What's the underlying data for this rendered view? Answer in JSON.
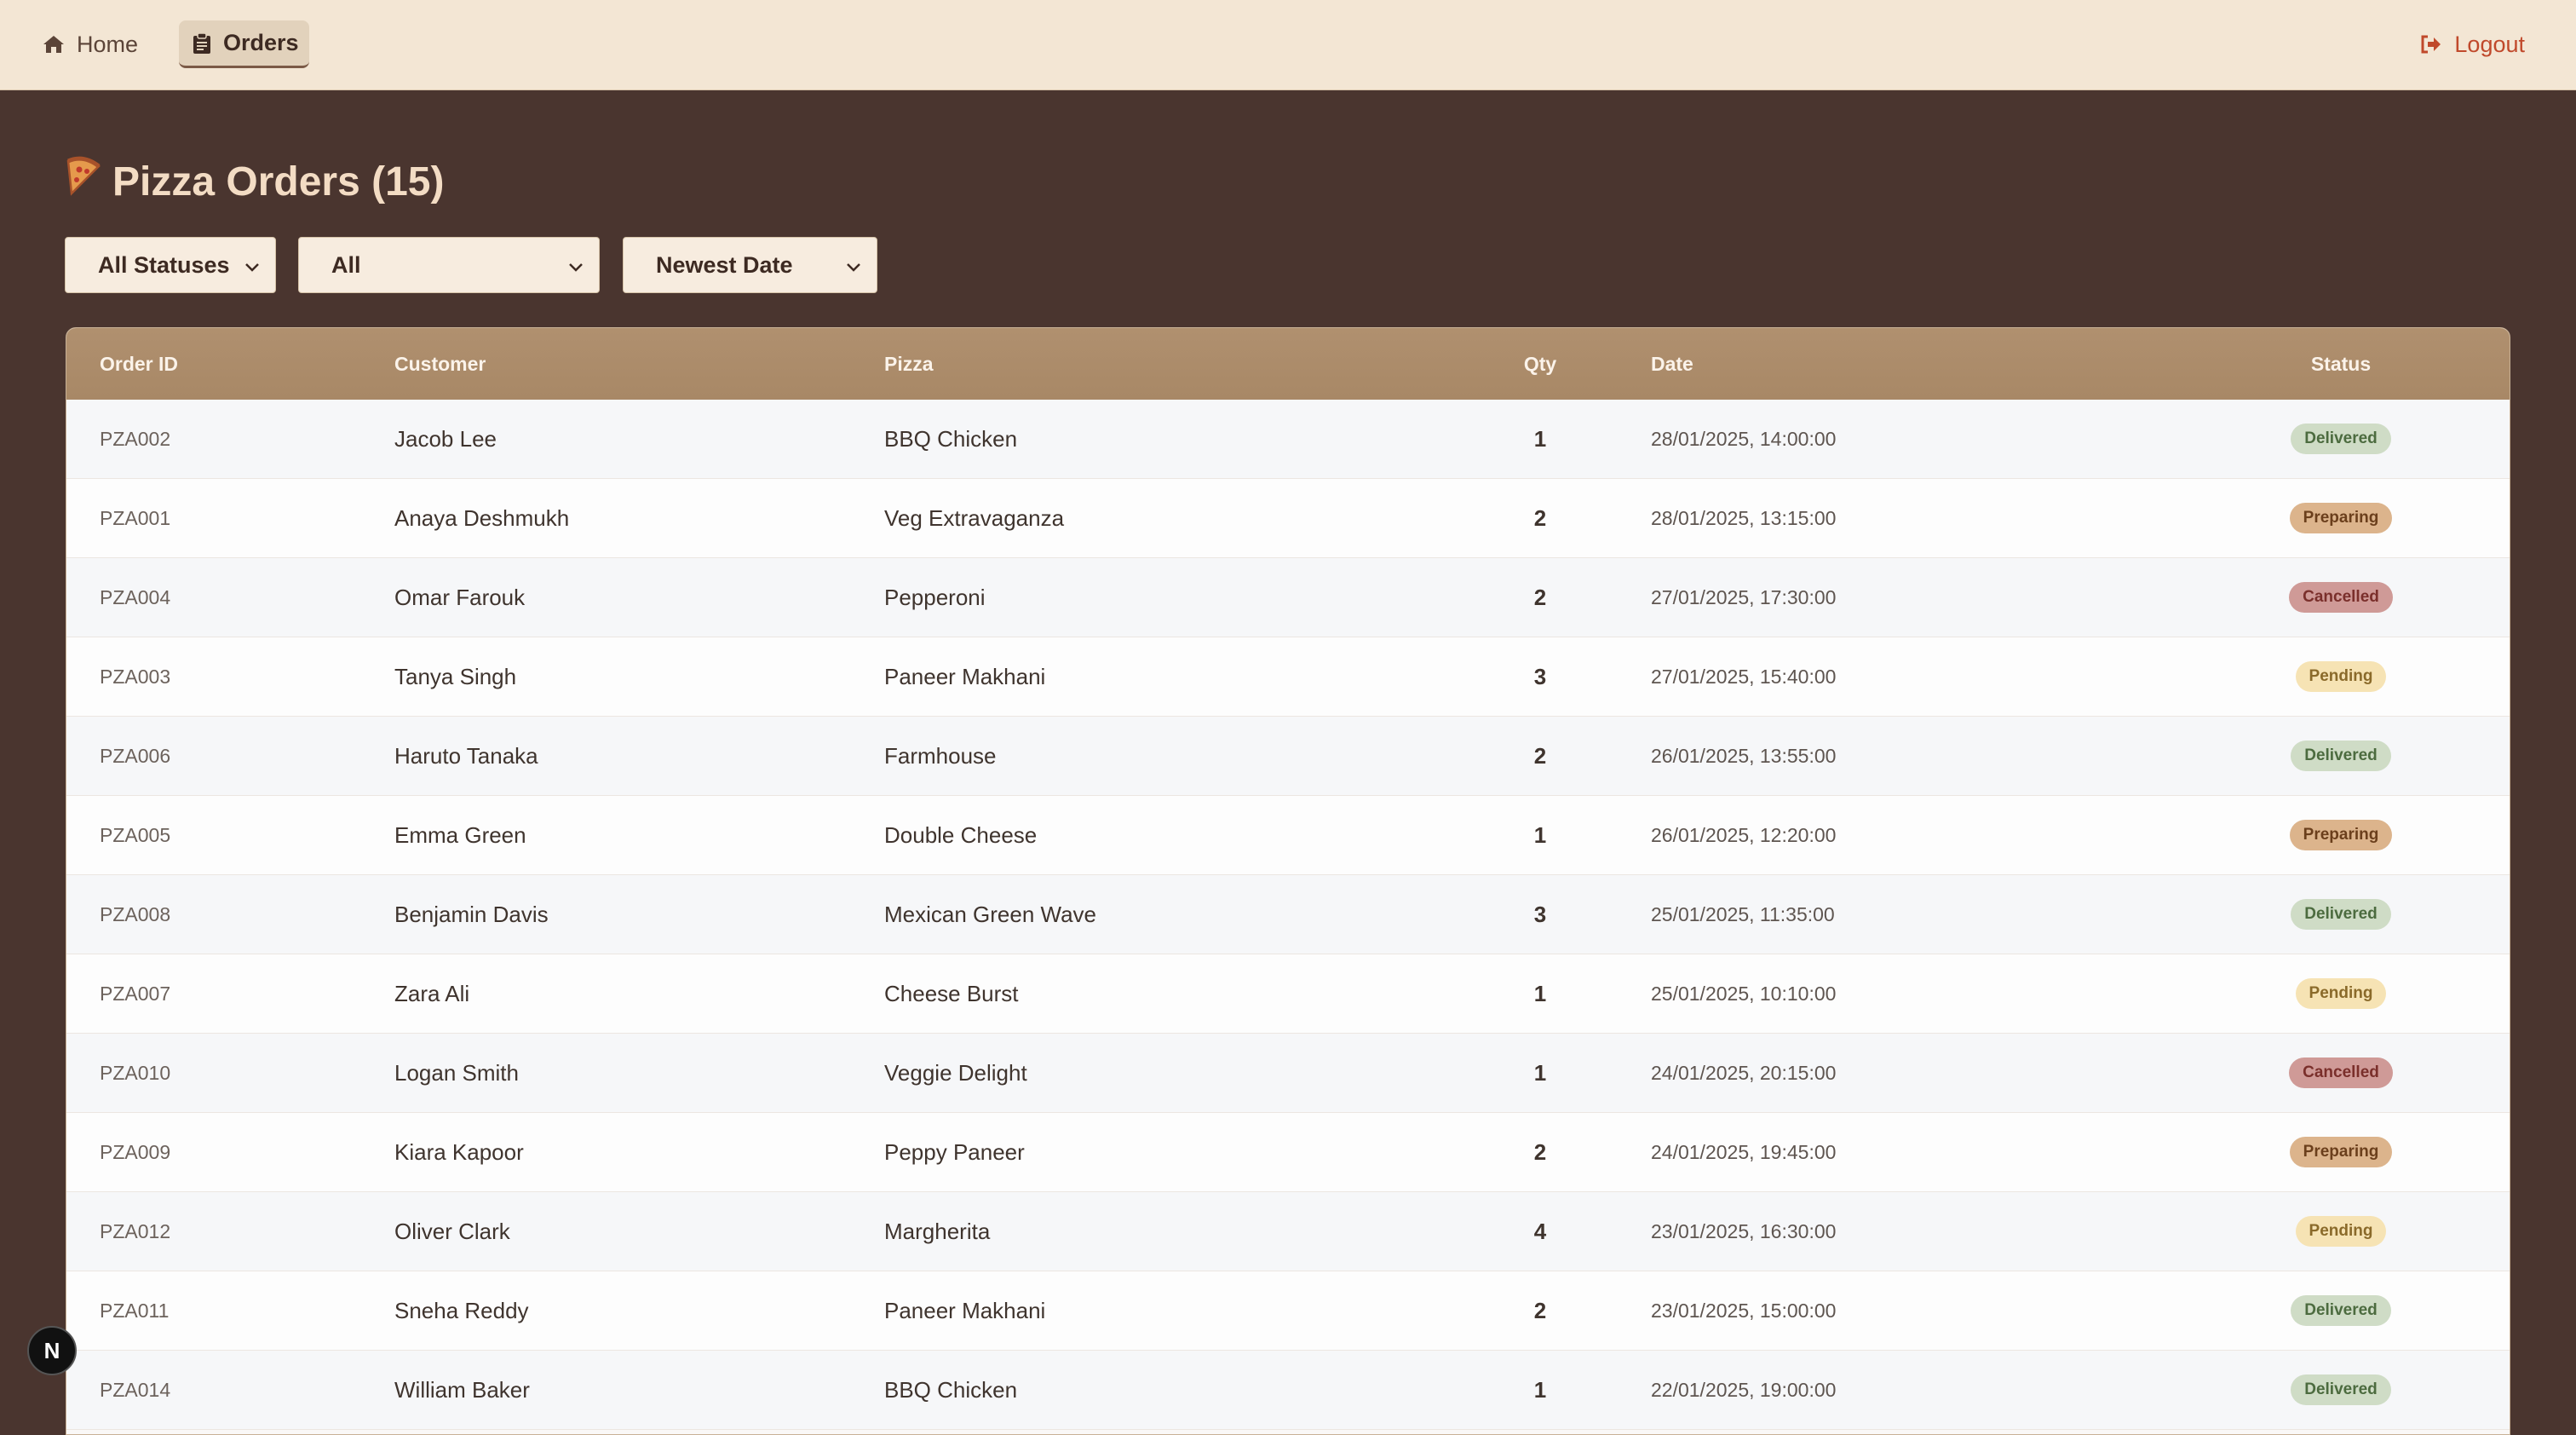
{
  "nav": {
    "home_label": "Home",
    "orders_label": "Orders",
    "logout_label": "Logout"
  },
  "page": {
    "title": "Pizza Orders (15)"
  },
  "filters": {
    "status_value": "All Statuses",
    "type_value": "All",
    "sort_value": "Newest Date"
  },
  "table": {
    "headers": {
      "order_id": "Order ID",
      "customer": "Customer",
      "pizza": "Pizza",
      "qty": "Qty",
      "date": "Date",
      "status": "Status"
    },
    "rows": [
      {
        "id": "PZA002",
        "customer": "Jacob Lee",
        "pizza": "BBQ Chicken",
        "qty": "1",
        "date": "28/01/2025, 14:00:00",
        "status": "Delivered"
      },
      {
        "id": "PZA001",
        "customer": "Anaya Deshmukh",
        "pizza": "Veg Extravaganza",
        "qty": "2",
        "date": "28/01/2025, 13:15:00",
        "status": "Preparing"
      },
      {
        "id": "PZA004",
        "customer": "Omar Farouk",
        "pizza": "Pepperoni",
        "qty": "2",
        "date": "27/01/2025, 17:30:00",
        "status": "Cancelled"
      },
      {
        "id": "PZA003",
        "customer": "Tanya Singh",
        "pizza": "Paneer Makhani",
        "qty": "3",
        "date": "27/01/2025, 15:40:00",
        "status": "Pending"
      },
      {
        "id": "PZA006",
        "customer": "Haruto Tanaka",
        "pizza": "Farmhouse",
        "qty": "2",
        "date": "26/01/2025, 13:55:00",
        "status": "Delivered"
      },
      {
        "id": "PZA005",
        "customer": "Emma Green",
        "pizza": "Double Cheese",
        "qty": "1",
        "date": "26/01/2025, 12:20:00",
        "status": "Preparing"
      },
      {
        "id": "PZA008",
        "customer": "Benjamin Davis",
        "pizza": "Mexican Green Wave",
        "qty": "3",
        "date": "25/01/2025, 11:35:00",
        "status": "Delivered"
      },
      {
        "id": "PZA007",
        "customer": "Zara Ali",
        "pizza": "Cheese Burst",
        "qty": "1",
        "date": "25/01/2025, 10:10:00",
        "status": "Pending"
      },
      {
        "id": "PZA010",
        "customer": "Logan Smith",
        "pizza": "Veggie Delight",
        "qty": "1",
        "date": "24/01/2025, 20:15:00",
        "status": "Cancelled"
      },
      {
        "id": "PZA009",
        "customer": "Kiara Kapoor",
        "pizza": "Peppy Paneer",
        "qty": "2",
        "date": "24/01/2025, 19:45:00",
        "status": "Preparing"
      },
      {
        "id": "PZA012",
        "customer": "Oliver Clark",
        "pizza": "Margherita",
        "qty": "4",
        "date": "23/01/2025, 16:30:00",
        "status": "Pending"
      },
      {
        "id": "PZA011",
        "customer": "Sneha Reddy",
        "pizza": "Paneer Makhani",
        "qty": "2",
        "date": "23/01/2025, 15:00:00",
        "status": "Delivered"
      },
      {
        "id": "PZA014",
        "customer": "William Baker",
        "pizza": "BBQ Chicken",
        "qty": "1",
        "date": "22/01/2025, 19:00:00",
        "status": "Delivered"
      }
    ]
  },
  "dev_badge": {
    "label": "N"
  },
  "colors": {
    "background": "#4a352f",
    "nav_background": "#f3e6d4",
    "header_background": "#a88866",
    "logout": "#c0492b",
    "delivered": "#cfdcc6",
    "preparing": "#dcb48c",
    "cancelled": "#cf9a97",
    "pending": "#f6e3b4"
  }
}
